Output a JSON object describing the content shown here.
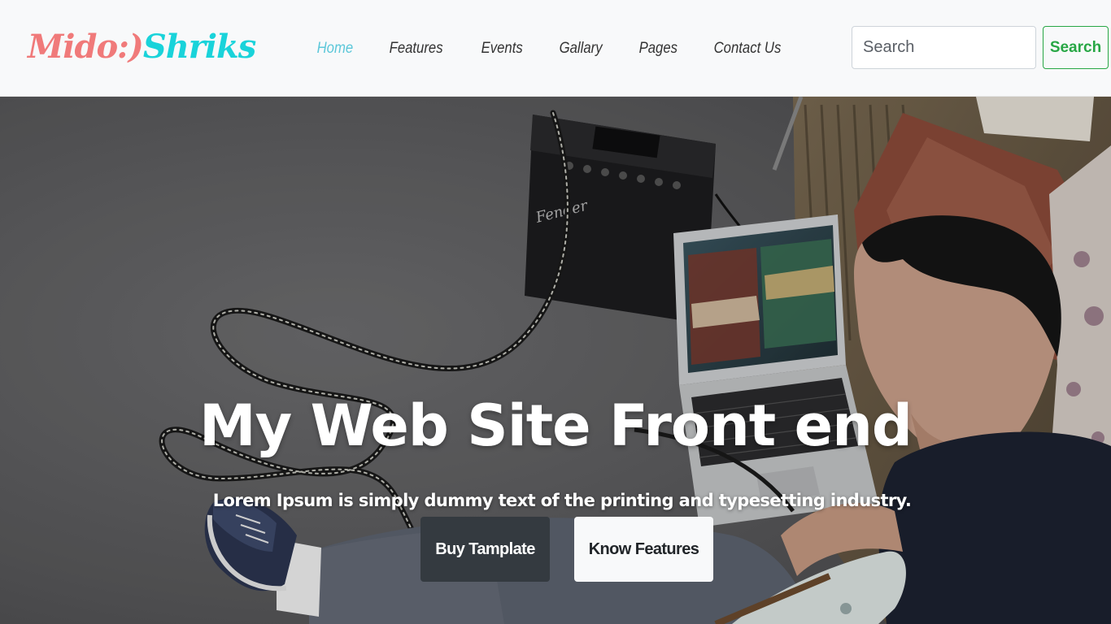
{
  "navbar": {
    "brand_part1": "Mido:)",
    "brand_part2": "Shriks",
    "links": [
      {
        "label": "Home",
        "active": true
      },
      {
        "label": "Features",
        "active": false
      },
      {
        "label": "Events",
        "active": false
      },
      {
        "label": "Gallary",
        "active": false
      },
      {
        "label": "Pages",
        "active": false
      },
      {
        "label": "Contact Us",
        "active": false
      }
    ],
    "search_placeholder": "Search",
    "search_button": "Search"
  },
  "hero": {
    "title": "My Web Site Front end",
    "subtitle": "Lorem Ipsum is simply dummy text of the printing and typesetting industry.",
    "primary_button": "Buy Tamplate",
    "secondary_button": "Know Features"
  },
  "colors": {
    "brand_pink": "#f07a7a",
    "brand_cyan": "#19d3da",
    "nav_active": "#5bc7d9",
    "search_green": "#28a745",
    "dark_button": "#343a40"
  }
}
